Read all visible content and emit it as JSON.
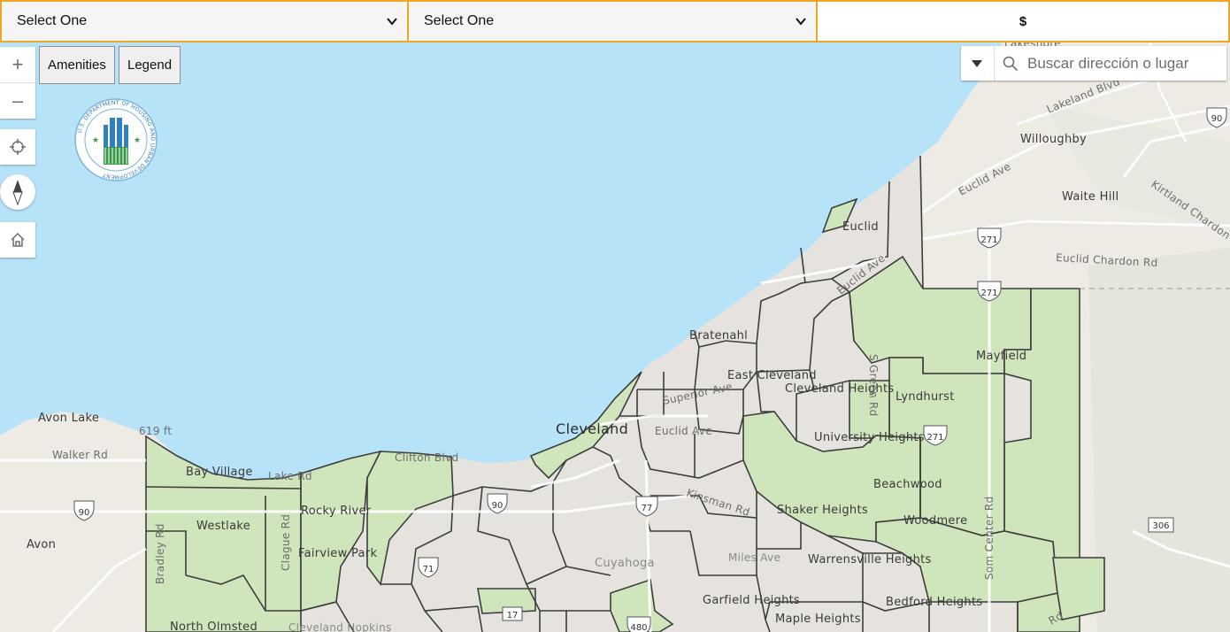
{
  "filters": {
    "select1": "Select One",
    "select2": "Select One",
    "price_symbol": "$"
  },
  "buttons": {
    "amenities": "Amenities",
    "legend": "Legend"
  },
  "controls": {
    "zoom_in": "+",
    "zoom_out": "–"
  },
  "search": {
    "placeholder": "Buscar dirección o lugar"
  },
  "logo_text": "U.S. DEPARTMENT OF HOUSING AND URBAN DEVELOPMENT",
  "map_labels": {
    "willoughby": "Willoughby",
    "waite_hill": "Waite Hill",
    "lakeland": "Lakeland Blvd",
    "kirtland": "Kirtland Chardon",
    "euclid_ave_ne": "Euclid Ave",
    "euclid_chardon": "Euclid Chardon Rd",
    "euclid": "Euclid",
    "euclid_ave_mid": "Euclid Ave",
    "bratenahl": "Bratenahl",
    "east_cleveland": "East Cleveland",
    "cleveland_heights": "Cleveland Heights",
    "superior": "Superior Ave",
    "green_rd": "S Green Rd",
    "mayfield": "Mayfield",
    "lyndhurst": "Lyndhurst",
    "university_heights": "University Heights",
    "beachwood": "Beachwood",
    "cleveland": "Cleveland",
    "euclid_ave_city": "Euclid Ave",
    "kinsman": "Kinsman Rd",
    "shaker": "Shaker Heights",
    "woodmere": "Woodmere",
    "som_center": "Som Center Rd",
    "miles_ave": "Miles Ave",
    "warrensville": "Warrensville Heights",
    "garfield": "Garfield Heights",
    "maple": "Maple Heights",
    "bedford": "Bedford Heights",
    "cuyahoga": "Cuyahoga",
    "avon_lake": "Avon Lake",
    "elevation": "619 ft",
    "walker_rd": "Walker Rd",
    "avon": "Avon",
    "bay_village": "Bay Village",
    "lake_rd": "Lake Rd",
    "clifton": "Clifton Blvd",
    "westlake": "Westlake",
    "rocky_river": "Rocky River",
    "fairview": "Fairview Park",
    "bradley": "Bradley Rd",
    "clague": "Clague Rd",
    "north_olmsted": "North Olmsted",
    "cleveland_hopkins": "Cleveland Hopkins",
    "lakeshore_top": "Lakeshore",
    "rd_bottom": "Rd",
    "shield_90_nw": "90",
    "shield_90_w": "90",
    "shield_90_city": "90",
    "shield_271_a": "271",
    "shield_271_b": "271",
    "shield_271_c": "271",
    "shield_77": "77",
    "shield_71": "71",
    "shield_17": "17",
    "shield_480": "480",
    "shield_306": "306"
  },
  "colors": {
    "water": "#b7e3f9",
    "land": "#eeeae4",
    "urban": "#e5e1dc",
    "highlight": "#cfe6bc",
    "boundary": "#3d3d3d",
    "filter_border": "#f0a523"
  }
}
